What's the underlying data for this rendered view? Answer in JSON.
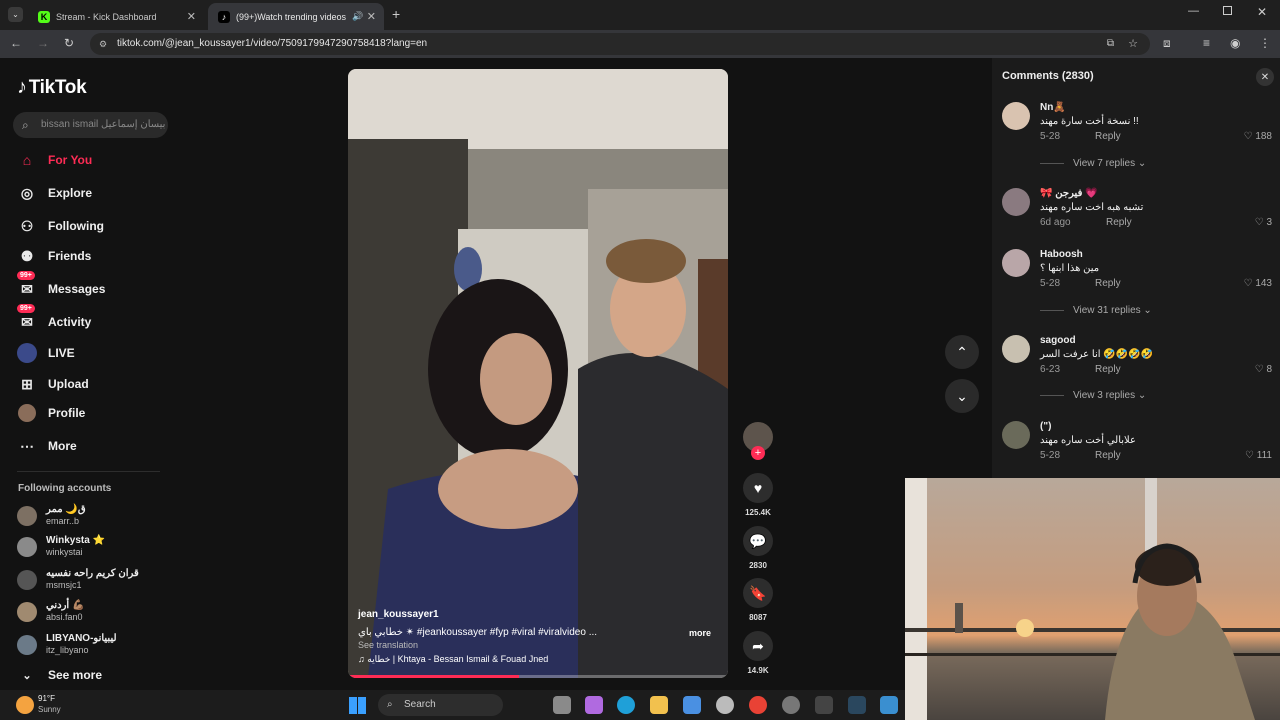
{
  "browser": {
    "tabs": [
      {
        "title": "Stream - Kick Dashboard",
        "icon": "kick-icon"
      },
      {
        "title": "(99+)Watch trending videos",
        "icon": "tiktok-icon"
      }
    ],
    "url": "tiktok.com/@jean_koussayer1/video/7509179947290758418?lang=en"
  },
  "sidebar": {
    "logo": "TikTok",
    "search_placeholder": "bissan ismail بيسان إسماعيل",
    "items": [
      {
        "label": "For You",
        "icon": "home-icon"
      },
      {
        "label": "Explore",
        "icon": "compass-icon"
      },
      {
        "label": "Following",
        "icon": "following-icon"
      },
      {
        "label": "Friends",
        "icon": "friends-icon"
      },
      {
        "label": "Messages",
        "icon": "messages-icon",
        "badge": "99+"
      },
      {
        "label": "Activity",
        "icon": "activity-icon",
        "badge": "99+"
      },
      {
        "label": "LIVE",
        "icon": "live-icon"
      },
      {
        "label": "Upload",
        "icon": "upload-icon"
      },
      {
        "label": "Profile",
        "icon": "profile-icon"
      },
      {
        "label": "More",
        "icon": "more-icon"
      }
    ],
    "following_header": "Following accounts",
    "accounts": [
      {
        "name": "ق🌙 ممر",
        "handle": "emarr..b"
      },
      {
        "name": "Winkysta ⭐",
        "handle": "winkystai"
      },
      {
        "name": "قران كريم راحه نفسيه",
        "handle": "msmsjc1"
      },
      {
        "name": "أردني 💪🏽",
        "handle": "absi.fan0"
      },
      {
        "name": "LIBYANO-ليبيانو",
        "handle": "itz_libyano"
      }
    ],
    "see_more": "See more"
  },
  "video": {
    "author": "jean_koussayer1",
    "caption": "خطابي باي ✴ #jeankoussayer #fyp #viral #viralvideo ...",
    "more": "more",
    "see_translation": "See translation",
    "sound": "♫ خطايه | Khtaya - Bessan Ismail & Fouad Jned",
    "progress": 0.45,
    "likes": "125.4K",
    "comments": "2830",
    "saves": "8087",
    "shares": "14.9K"
  },
  "comments_panel": {
    "title": "Comments (2830)",
    "items": [
      {
        "user": "Nn🧸",
        "text": "نسخة أخت سارة مهند !!",
        "date": "5-28",
        "likes": "188",
        "replies": "View 7 replies"
      },
      {
        "user": "🎀 فيرجن 💗",
        "text": "تشبه هبه اخت ساره مهند",
        "date": "6d ago",
        "likes": "3",
        "replies": ""
      },
      {
        "user": "Haboosh",
        "text": "مين هذا ابنها ؟",
        "date": "5-28",
        "likes": "143",
        "replies": "View 31 replies"
      },
      {
        "user": "sagood",
        "text": "انا عرفت السر 🤣🤣🤣🤣",
        "date": "6-23",
        "likes": "8",
        "replies": "View 3 replies"
      },
      {
        "user": "(\")",
        "text": "علابالي أخت ساره مهند",
        "date": "5-28",
        "likes": "111",
        "replies": ""
      }
    ],
    "reply_label": "Reply"
  },
  "taskbar": {
    "weather_temp": "91°F",
    "weather_desc": "Sunny",
    "search": "Search"
  },
  "colors": {
    "accent": "#fe2c55",
    "bg": "#121212"
  }
}
